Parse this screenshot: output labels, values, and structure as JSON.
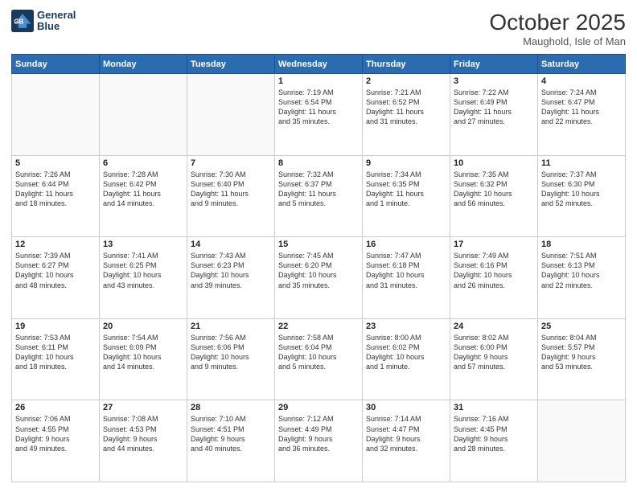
{
  "logo": {
    "line1": "General",
    "line2": "Blue"
  },
  "title": "October 2025",
  "subtitle": "Maughold, Isle of Man",
  "weekdays": [
    "Sunday",
    "Monday",
    "Tuesday",
    "Wednesday",
    "Thursday",
    "Friday",
    "Saturday"
  ],
  "weeks": [
    [
      {
        "day": "",
        "info": ""
      },
      {
        "day": "",
        "info": ""
      },
      {
        "day": "",
        "info": ""
      },
      {
        "day": "1",
        "info": "Sunrise: 7:19 AM\nSunset: 6:54 PM\nDaylight: 11 hours\nand 35 minutes."
      },
      {
        "day": "2",
        "info": "Sunrise: 7:21 AM\nSunset: 6:52 PM\nDaylight: 11 hours\nand 31 minutes."
      },
      {
        "day": "3",
        "info": "Sunrise: 7:22 AM\nSunset: 6:49 PM\nDaylight: 11 hours\nand 27 minutes."
      },
      {
        "day": "4",
        "info": "Sunrise: 7:24 AM\nSunset: 6:47 PM\nDaylight: 11 hours\nand 22 minutes."
      }
    ],
    [
      {
        "day": "5",
        "info": "Sunrise: 7:26 AM\nSunset: 6:44 PM\nDaylight: 11 hours\nand 18 minutes."
      },
      {
        "day": "6",
        "info": "Sunrise: 7:28 AM\nSunset: 6:42 PM\nDaylight: 11 hours\nand 14 minutes."
      },
      {
        "day": "7",
        "info": "Sunrise: 7:30 AM\nSunset: 6:40 PM\nDaylight: 11 hours\nand 9 minutes."
      },
      {
        "day": "8",
        "info": "Sunrise: 7:32 AM\nSunset: 6:37 PM\nDaylight: 11 hours\nand 5 minutes."
      },
      {
        "day": "9",
        "info": "Sunrise: 7:34 AM\nSunset: 6:35 PM\nDaylight: 11 hours\nand 1 minute."
      },
      {
        "day": "10",
        "info": "Sunrise: 7:35 AM\nSunset: 6:32 PM\nDaylight: 10 hours\nand 56 minutes."
      },
      {
        "day": "11",
        "info": "Sunrise: 7:37 AM\nSunset: 6:30 PM\nDaylight: 10 hours\nand 52 minutes."
      }
    ],
    [
      {
        "day": "12",
        "info": "Sunrise: 7:39 AM\nSunset: 6:27 PM\nDaylight: 10 hours\nand 48 minutes."
      },
      {
        "day": "13",
        "info": "Sunrise: 7:41 AM\nSunset: 6:25 PM\nDaylight: 10 hours\nand 43 minutes."
      },
      {
        "day": "14",
        "info": "Sunrise: 7:43 AM\nSunset: 6:23 PM\nDaylight: 10 hours\nand 39 minutes."
      },
      {
        "day": "15",
        "info": "Sunrise: 7:45 AM\nSunset: 6:20 PM\nDaylight: 10 hours\nand 35 minutes."
      },
      {
        "day": "16",
        "info": "Sunrise: 7:47 AM\nSunset: 6:18 PM\nDaylight: 10 hours\nand 31 minutes."
      },
      {
        "day": "17",
        "info": "Sunrise: 7:49 AM\nSunset: 6:16 PM\nDaylight: 10 hours\nand 26 minutes."
      },
      {
        "day": "18",
        "info": "Sunrise: 7:51 AM\nSunset: 6:13 PM\nDaylight: 10 hours\nand 22 minutes."
      }
    ],
    [
      {
        "day": "19",
        "info": "Sunrise: 7:53 AM\nSunset: 6:11 PM\nDaylight: 10 hours\nand 18 minutes."
      },
      {
        "day": "20",
        "info": "Sunrise: 7:54 AM\nSunset: 6:09 PM\nDaylight: 10 hours\nand 14 minutes."
      },
      {
        "day": "21",
        "info": "Sunrise: 7:56 AM\nSunset: 6:06 PM\nDaylight: 10 hours\nand 9 minutes."
      },
      {
        "day": "22",
        "info": "Sunrise: 7:58 AM\nSunset: 6:04 PM\nDaylight: 10 hours\nand 5 minutes."
      },
      {
        "day": "23",
        "info": "Sunrise: 8:00 AM\nSunset: 6:02 PM\nDaylight: 10 hours\nand 1 minute."
      },
      {
        "day": "24",
        "info": "Sunrise: 8:02 AM\nSunset: 6:00 PM\nDaylight: 9 hours\nand 57 minutes."
      },
      {
        "day": "25",
        "info": "Sunrise: 8:04 AM\nSunset: 5:57 PM\nDaylight: 9 hours\nand 53 minutes."
      }
    ],
    [
      {
        "day": "26",
        "info": "Sunrise: 7:06 AM\nSunset: 4:55 PM\nDaylight: 9 hours\nand 49 minutes."
      },
      {
        "day": "27",
        "info": "Sunrise: 7:08 AM\nSunset: 4:53 PM\nDaylight: 9 hours\nand 44 minutes."
      },
      {
        "day": "28",
        "info": "Sunrise: 7:10 AM\nSunset: 4:51 PM\nDaylight: 9 hours\nand 40 minutes."
      },
      {
        "day": "29",
        "info": "Sunrise: 7:12 AM\nSunset: 4:49 PM\nDaylight: 9 hours\nand 36 minutes."
      },
      {
        "day": "30",
        "info": "Sunrise: 7:14 AM\nSunset: 4:47 PM\nDaylight: 9 hours\nand 32 minutes."
      },
      {
        "day": "31",
        "info": "Sunrise: 7:16 AM\nSunset: 4:45 PM\nDaylight: 9 hours\nand 28 minutes."
      },
      {
        "day": "",
        "info": ""
      }
    ]
  ]
}
